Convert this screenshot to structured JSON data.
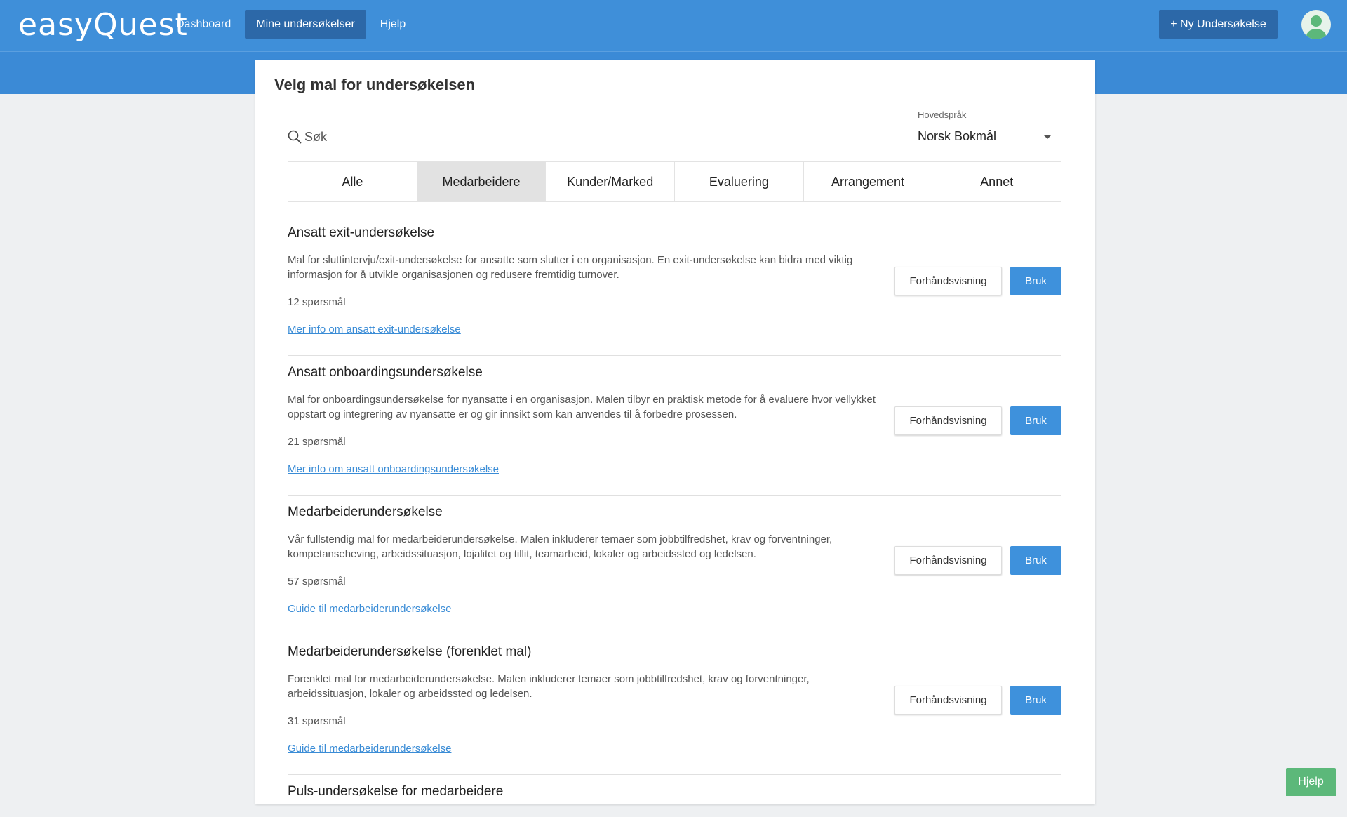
{
  "app": {
    "logo_text": "easyQuest"
  },
  "nav": {
    "items": [
      {
        "label": "Dashboard",
        "active": false
      },
      {
        "label": "Mine undersøkelser",
        "active": true
      },
      {
        "label": "Hjelp",
        "active": false
      }
    ],
    "new_survey_label": "+ Ny Undersøkelse"
  },
  "page": {
    "title": "Velg mal for undersøkelsen"
  },
  "search": {
    "placeholder": "Søk",
    "value": ""
  },
  "language": {
    "label": "Hovedspråk",
    "selected": "Norsk Bokmål"
  },
  "tabs": [
    {
      "label": "Alle",
      "active": false
    },
    {
      "label": "Medarbeidere",
      "active": true
    },
    {
      "label": "Kunder/Marked",
      "active": false
    },
    {
      "label": "Evaluering",
      "active": false
    },
    {
      "label": "Arrangement",
      "active": false
    },
    {
      "label": "Annet",
      "active": false
    }
  ],
  "templates": [
    {
      "title": "Ansatt exit-undersøkelse",
      "description": "Mal for sluttintervju/exit-undersøkelse for ansatte som slutter i en organisasjon. En exit-undersøkelse kan bidra med viktig informasjon for å utvikle organisasjonen og redusere fremtidig turnover.",
      "count": "12 spørsmål",
      "link": "Mer info om ansatt exit-undersøkelse",
      "preview_label": "Forhåndsvisning",
      "use_label": "Bruk"
    },
    {
      "title": "Ansatt onboardingsundersøkelse",
      "description": "Mal for onboardingsundersøkelse for nyansatte i en organisasjon. Malen tilbyr en praktisk metode for å evaluere hvor vellykket oppstart og integrering av nyansatte er og gir innsikt som kan anvendes til å forbedre prosessen.",
      "count": "21 spørsmål",
      "link": "Mer info om ansatt onboardingsundersøkelse",
      "preview_label": "Forhåndsvisning",
      "use_label": "Bruk"
    },
    {
      "title": "Medarbeiderundersøkelse",
      "description": "Vår fullstendig mal for medarbeiderundersøkelse. Malen inkluderer temaer som jobbtilfredshet, krav og forventninger, kompetanseheving, arbeidssituasjon, lojalitet og tillit, teamarbeid, lokaler og arbeidssted og ledelsen.",
      "count": "57 spørsmål",
      "link": "Guide til medarbeiderundersøkelse",
      "preview_label": "Forhåndsvisning",
      "use_label": "Bruk"
    },
    {
      "title": "Medarbeiderundersøkelse (forenklet mal)",
      "description": "Forenklet mal for medarbeiderundersøkelse. Malen inkluderer temaer som jobbtilfredshet, krav og forventninger, arbeidssituasjon, lokaler og arbeidssted og ledelsen.",
      "count": "31 spørsmål",
      "link": "Guide til medarbeiderundersøkelse",
      "preview_label": "Forhåndsvisning",
      "use_label": "Bruk"
    }
  ],
  "partial_template": {
    "title": "Puls-undersøkelse for medarbeidere"
  },
  "help_fab": {
    "label": "Hjelp"
  },
  "colors": {
    "header": "#3f8fd9",
    "nav_active": "#2c68a8",
    "primary_button": "#3e91dc",
    "link": "#3a8cd6",
    "help_button": "#5cb87a"
  }
}
